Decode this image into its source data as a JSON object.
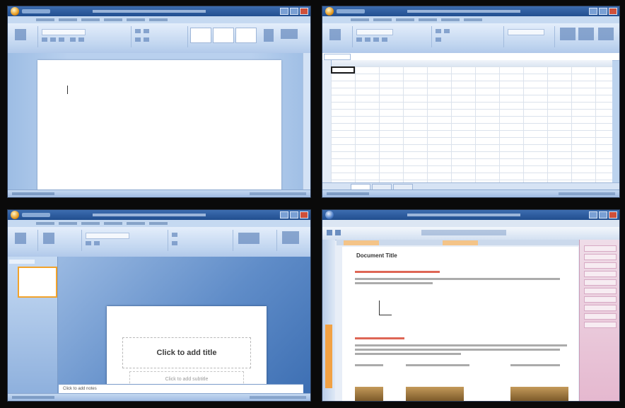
{
  "ppt": {
    "title_placeholder": "Click to add title",
    "subtitle_placeholder": "Click to add subtitle",
    "notes_placeholder": "Click to add notes"
  },
  "browser": {
    "heading": "Document Title"
  }
}
